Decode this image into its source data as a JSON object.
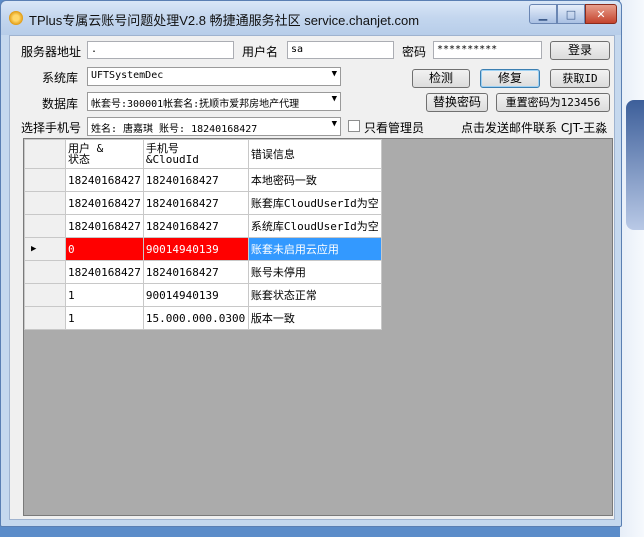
{
  "window": {
    "title": "TPlus专属云账号问题处理V2.8  畅捷通服务社区 service.chanjet.com"
  },
  "form": {
    "server_label": "服务器地址",
    "server_value": ".",
    "user_label": "用户名",
    "user_value": "sa",
    "password_label": "密码",
    "password_value": "**********",
    "login_button": "登录",
    "sysdb_label": "系统库",
    "sysdb_value": "UFTSystemDec",
    "detect_button": "检测",
    "repair_button": "修复",
    "getid_button": "获取ID",
    "db_label": "数据库",
    "db_value": "帐套号:300001帐套名:抚顺市爱邦房地产代理",
    "replace_pwd_button": "替换密码",
    "reset_pwd_button": "重置密码为123456",
    "phone_label": "选择手机号",
    "phone_value": "姓名: 唐嘉琪 账号: 18240168427",
    "only_admin_label": "只看管理员",
    "contact_text": "点击发送邮件联系 CJT-王淼"
  },
  "grid": {
    "columns": [
      {
        "line1": "用户  &",
        "line2": "状态"
      },
      {
        "line1": "手机号",
        "line2": "&CloudId"
      },
      {
        "line1": "错误信息",
        "line2": ""
      }
    ],
    "rows": [
      [
        "18240168427",
        "18240168427",
        "本地密码一致"
      ],
      [
        "18240168427",
        "18240168427",
        "账套库CloudUserId为空"
      ],
      [
        "18240168427",
        "18240168427",
        "系统库CloudUserId为空"
      ],
      [
        "0",
        "90014940139",
        "账套未启用云应用"
      ],
      [
        "18240168427",
        "18240168427",
        "账号未停用"
      ],
      [
        "1",
        "90014940139",
        "账套状态正常"
      ],
      [
        "1",
        "15.000.000.0300",
        "版本一致"
      ]
    ],
    "selected_row_index": 3,
    "selected_colors": {
      "user": "#ff0000",
      "error": "#3399ff"
    }
  }
}
